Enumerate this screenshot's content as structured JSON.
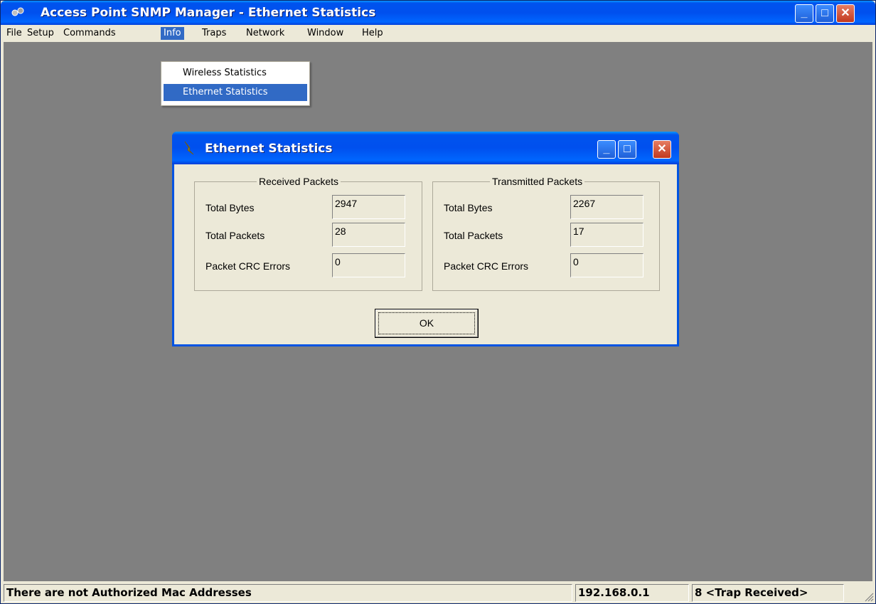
{
  "app": {
    "title": "Access Point SNMP Manager -  Ethernet Statistics",
    "icon": "network-app-icon",
    "minimize_glyph": "_",
    "maximize_glyph": "□",
    "close_glyph": "✕"
  },
  "menubar": {
    "items": [
      "File",
      "Setup",
      "Commands",
      "Info",
      "Traps",
      "Network",
      "Window",
      "Help"
    ],
    "active": "Info"
  },
  "info_menu": {
    "items": [
      "Wireless Statistics",
      "Ethernet Statistics"
    ],
    "selected": "Ethernet Statistics"
  },
  "dialog": {
    "title": "Ethernet Statistics",
    "icon": "lightning-icon",
    "received": {
      "title": "Received Packets",
      "total_bytes_label": "Total Bytes",
      "total_bytes": "2947",
      "total_packets_label": "Total Packets",
      "total_packets": "28",
      "crc_errors_label": "Packet CRC Errors",
      "crc_errors": "0"
    },
    "transmitted": {
      "title": "Transmitted Packets",
      "total_bytes_label": "Total Bytes",
      "total_bytes": "2267",
      "total_packets_label": "Total Packets",
      "total_packets": "17",
      "crc_errors_label": "Packet CRC Errors",
      "crc_errors": "0"
    },
    "ok_label": "OK"
  },
  "statusbar": {
    "message": "There are not Authorized Mac Addresses",
    "ip": "192.168.0.1",
    "traps": "8 <Trap Received>"
  },
  "colors": {
    "titlebar": "#0054e3",
    "workspace": "#808080",
    "menu_highlight": "#316ac5",
    "window_bg": "#ece9d8"
  }
}
